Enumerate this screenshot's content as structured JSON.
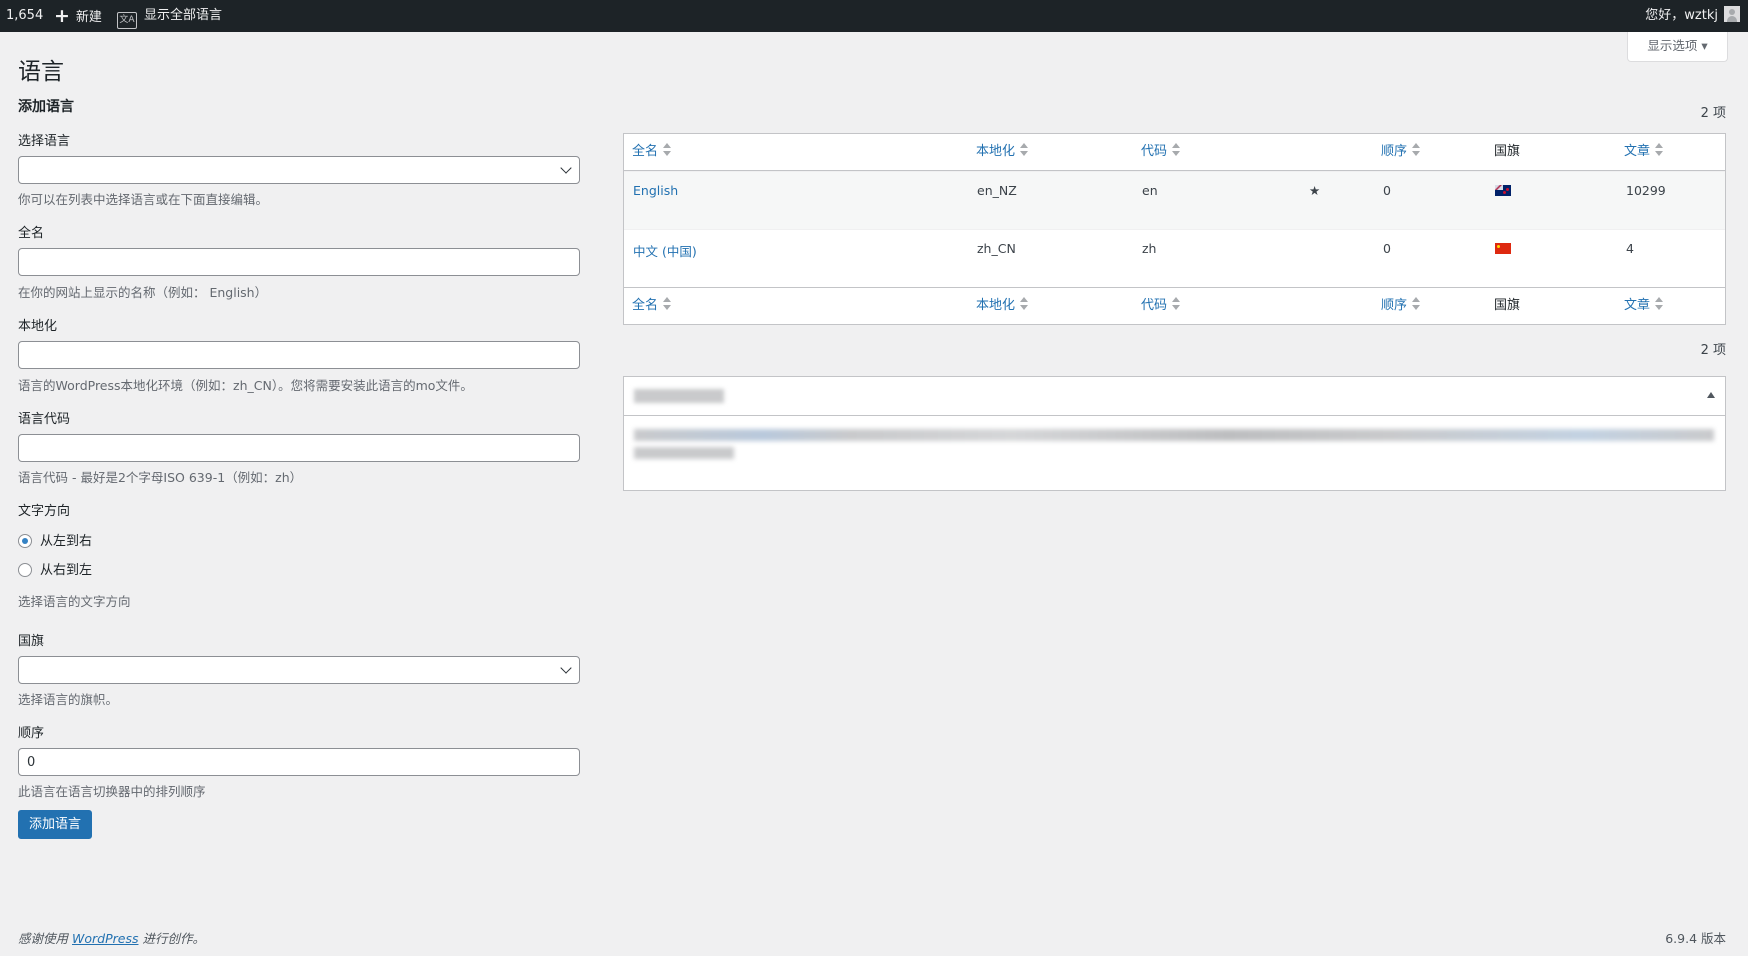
{
  "adminbar": {
    "comment_count": "1,654",
    "new_label": "新建",
    "show_all_languages": "显示全部语言",
    "greeting": "您好，wztkj"
  },
  "screen_options": "显示选项",
  "page_title": "语言",
  "form": {
    "title": "添加语言",
    "choose_language_label": "选择语言",
    "choose_language_value": "",
    "choose_language_hint": "你可以在列表中选择语言或在下面直接编辑。",
    "full_name_label": "全名",
    "full_name_value": "",
    "full_name_hint": "在你的网站上显示的名称（例如： English）",
    "locale_label": "本地化",
    "locale_value": "",
    "locale_hint": "语言的WordPress本地化环境（例如：zh_CN）。您将需要安装此语言的mo文件。",
    "code_label": "语言代码",
    "code_value": "",
    "code_hint": "语言代码 - 最好是2个字母ISO 639-1（例如：zh）",
    "direction_label": "文字方向",
    "direction_ltr": "从左到右",
    "direction_rtl": "从右到左",
    "direction_selected": "ltr",
    "direction_hint": "选择语言的文字方向",
    "flag_label": "国旗",
    "flag_value": "",
    "flag_hint": "选择语言的旗帜。",
    "order_label": "顺序",
    "order_value": "0",
    "order_hint": "此语言在语言切换器中的排列顺序",
    "submit_label": "添加语言"
  },
  "table": {
    "item_count": "2 项",
    "columns": {
      "name": "全名",
      "locale": "本地化",
      "code": "代码",
      "order": "顺序",
      "flag": "国旗",
      "posts": "文章"
    },
    "rows": [
      {
        "name": "English",
        "locale": "en_NZ",
        "code": "en",
        "default": "★",
        "order": "0",
        "flag_icon": "flag-nz-icon",
        "posts": "10299"
      },
      {
        "name": "中文 (中国)",
        "locale": "zh_CN",
        "code": "zh",
        "default": "",
        "order": "0",
        "flag_icon": "flag-cn-icon",
        "posts": "4"
      }
    ]
  },
  "footer": {
    "thanks_prefix": "感谢使用",
    "wordpress": "WordPress",
    "thanks_suffix": "进行创作。",
    "version": "6.9.4 版本"
  },
  "icons": {
    "new": "plus-icon",
    "languages": "translation-icon",
    "avatar": "avatar-icon",
    "select": "chevron-down-icon",
    "sort": "sort-arrows-icon",
    "default_language": "star-icon",
    "panel_toggle": "triangle-up-icon"
  },
  "colors": {
    "adminbar_bg": "#1d2327",
    "primary": "#2271b1",
    "page_bg": "#f0f0f1"
  }
}
